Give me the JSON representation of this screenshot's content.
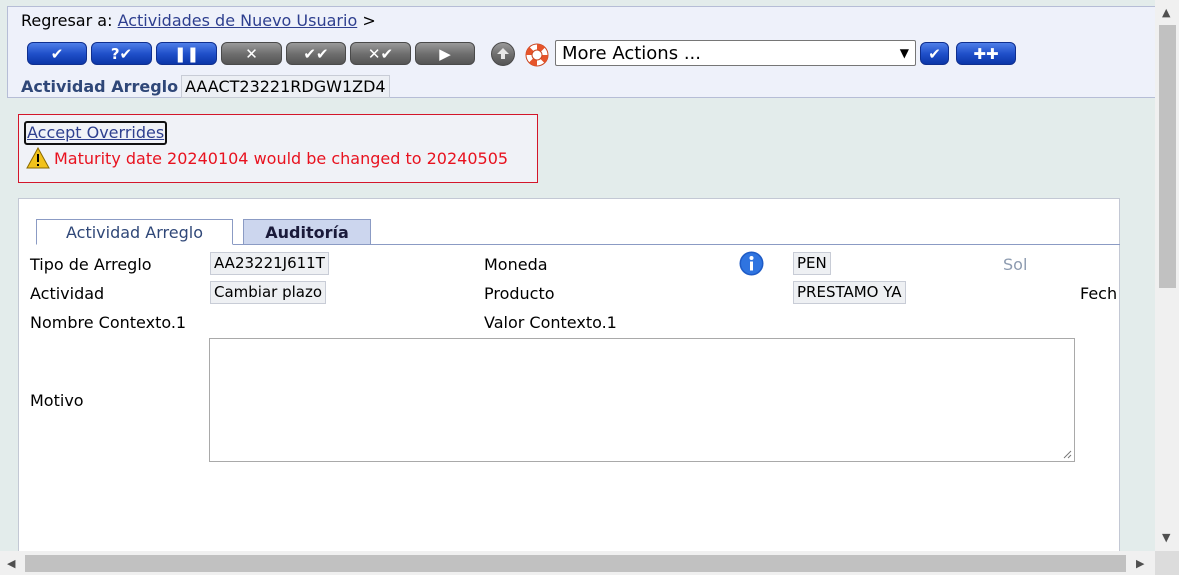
{
  "header": {
    "back_prefix": "Regresar a:",
    "back_link": "Actividades de Nuevo Usuario",
    "back_suffix": ">",
    "toolbar": {
      "buttons": [
        {
          "name": "commit-button",
          "label": "✔",
          "style": "blue"
        },
        {
          "name": "validate-button",
          "label": "?✔",
          "style": "blue"
        },
        {
          "name": "hold-button",
          "label": "❚❚",
          "style": "blue"
        },
        {
          "name": "delete-button",
          "label": "✕",
          "style": "grey"
        },
        {
          "name": "authorise-button",
          "label": "✔✔",
          "style": "grey"
        },
        {
          "name": "reverse-button",
          "label": "✕✔",
          "style": "grey"
        },
        {
          "name": "play-button",
          "label": "▶",
          "style": "grey"
        }
      ],
      "more_actions": "More Actions ..."
    },
    "arrangement_label": "Actividad Arreglo",
    "arrangement_value": "AAACT23221RDGW1ZD4"
  },
  "overrides": {
    "accept_label": "Accept Overrides",
    "message": "Maturity date 20240104 would be changed to 20240505"
  },
  "tabs": [
    {
      "label": "Actividad Arreglo",
      "active": true
    },
    {
      "label": "Auditoría",
      "active": false
    }
  ],
  "form": {
    "tipo_label": "Tipo de Arreglo",
    "tipo_value": "AA23221J611T",
    "actividad_label": "Actividad",
    "actividad_value": "Cambiar plazo",
    "nombre_contexto_label": "Nombre Contexto.1",
    "moneda_label": "Moneda",
    "moneda_value": "PEN",
    "moneda_desc": "Sol",
    "producto_label": "Producto",
    "producto_value": "PRESTAMO YA",
    "valor_contexto_label": "Valor Contexto.1",
    "fecha_label_partial": "Fech",
    "motivo_label": "Motivo",
    "motivo_value": ""
  },
  "colors": {
    "link": "#2e3f8f",
    "warning": "#e8121f",
    "button_blue": "#1f4fc9",
    "button_grey": "#6e6e6e"
  }
}
